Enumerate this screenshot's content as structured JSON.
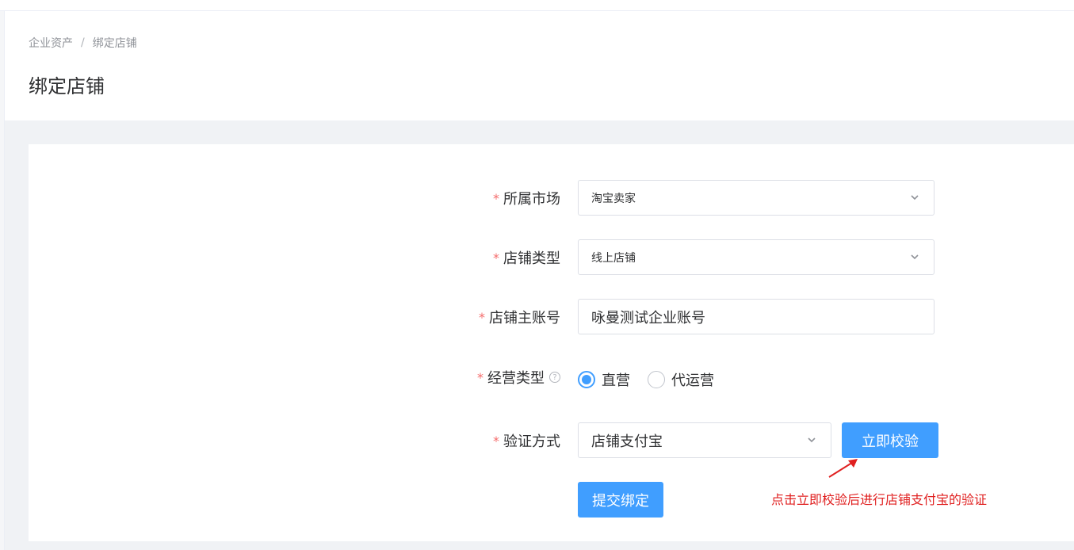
{
  "breadcrumb": {
    "items": [
      "企业资产",
      "绑定店铺"
    ],
    "separator": "/"
  },
  "page": {
    "title": "绑定店铺"
  },
  "form": {
    "required_mark": "*",
    "market": {
      "label": "所属市场",
      "value": "淘宝卖家"
    },
    "store_type": {
      "label": "店铺类型",
      "value": "线上店铺"
    },
    "main_account": {
      "label": "店铺主账号",
      "value": "咏曼测试企业账号"
    },
    "business_type": {
      "label": "经营类型",
      "help_icon": "question-circle-icon",
      "options": [
        {
          "label": "直营",
          "checked": true
        },
        {
          "label": "代运营",
          "checked": false
        }
      ]
    },
    "verify_method": {
      "label": "验证方式",
      "value": "店铺支付宝"
    },
    "verify_button": "立即校验",
    "submit_button": "提交绑定"
  },
  "annotation": {
    "text": "点击立即校验后进行店铺支付宝的验证",
    "color": "#e02020"
  },
  "colors": {
    "primary": "#409eff",
    "required": "#f56c6c",
    "background": "#f0f2f5"
  }
}
